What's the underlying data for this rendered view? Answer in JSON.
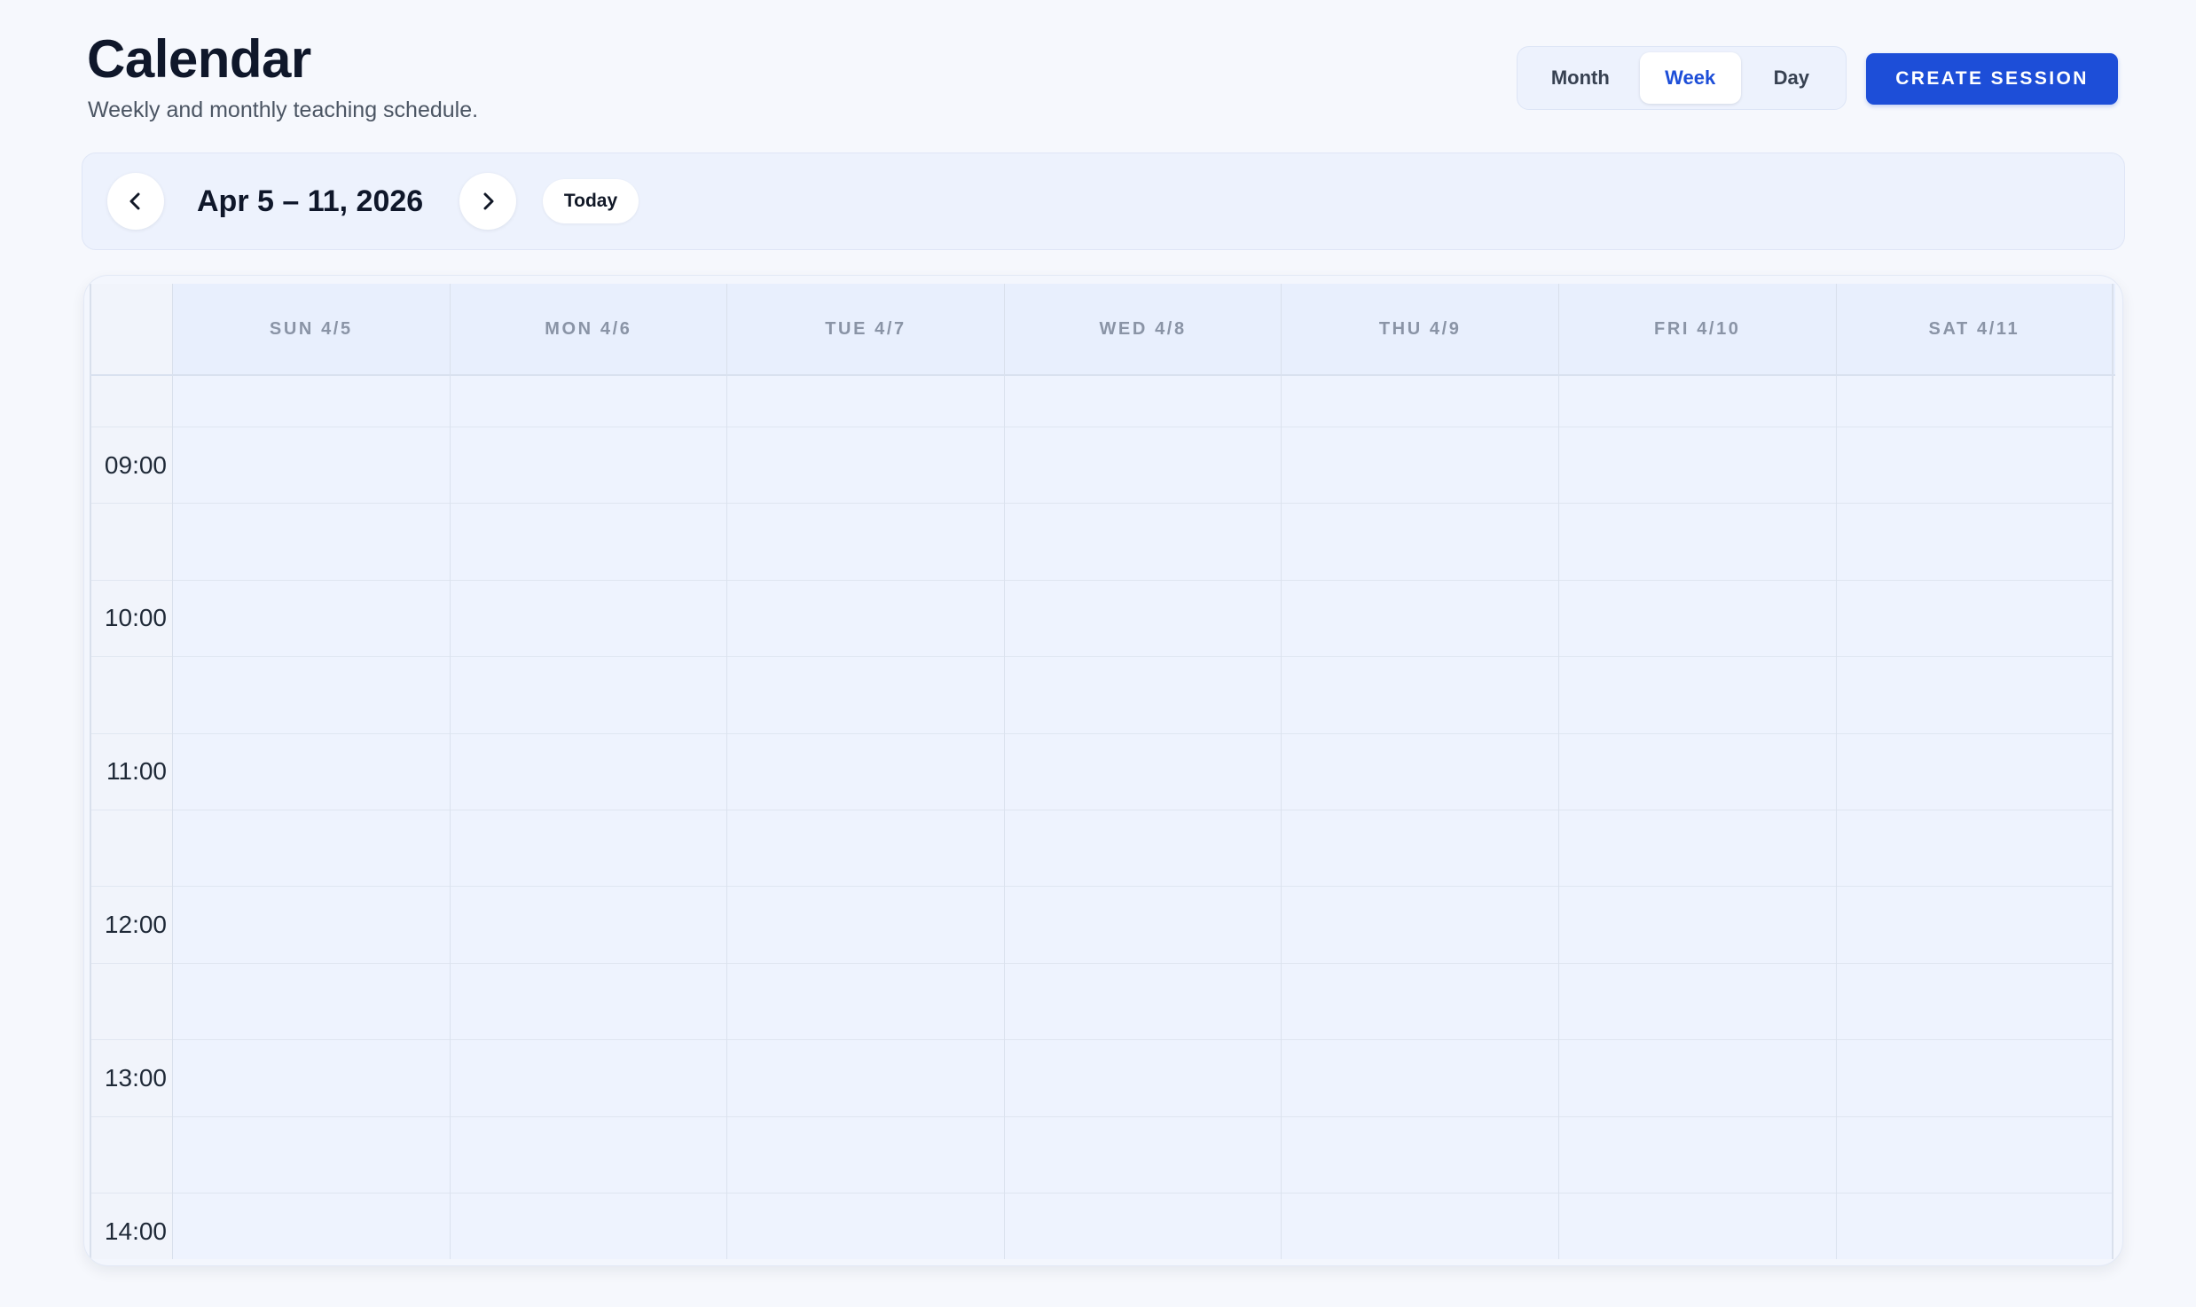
{
  "header": {
    "title": "Calendar",
    "subtitle": "Weekly and monthly teaching schedule."
  },
  "view_switch": {
    "options": [
      "Month",
      "Week",
      "Day"
    ],
    "selected": "Week"
  },
  "actions": {
    "create_label": "CREATE SESSION"
  },
  "toolbar": {
    "prev_icon": "chevron-left-icon",
    "next_icon": "chevron-right-icon",
    "range_label": "Apr 5 – 11, 2026",
    "today_label": "Today"
  },
  "calendar": {
    "days": [
      "SUN 4/5",
      "MON 4/6",
      "TUE 4/7",
      "WED 4/8",
      "THU 4/9",
      "FRI 4/10",
      "SAT 4/11"
    ],
    "time_labels": [
      "09:00",
      "10:00",
      "11:00",
      "12:00",
      "13:00",
      "14:00"
    ]
  },
  "colors": {
    "accent": "#1d4ed8",
    "page_background": "#f6f8fd",
    "grid_background": "#eef3fe",
    "header_background": "#e8effd",
    "day_header_text": "#8a94a6"
  }
}
